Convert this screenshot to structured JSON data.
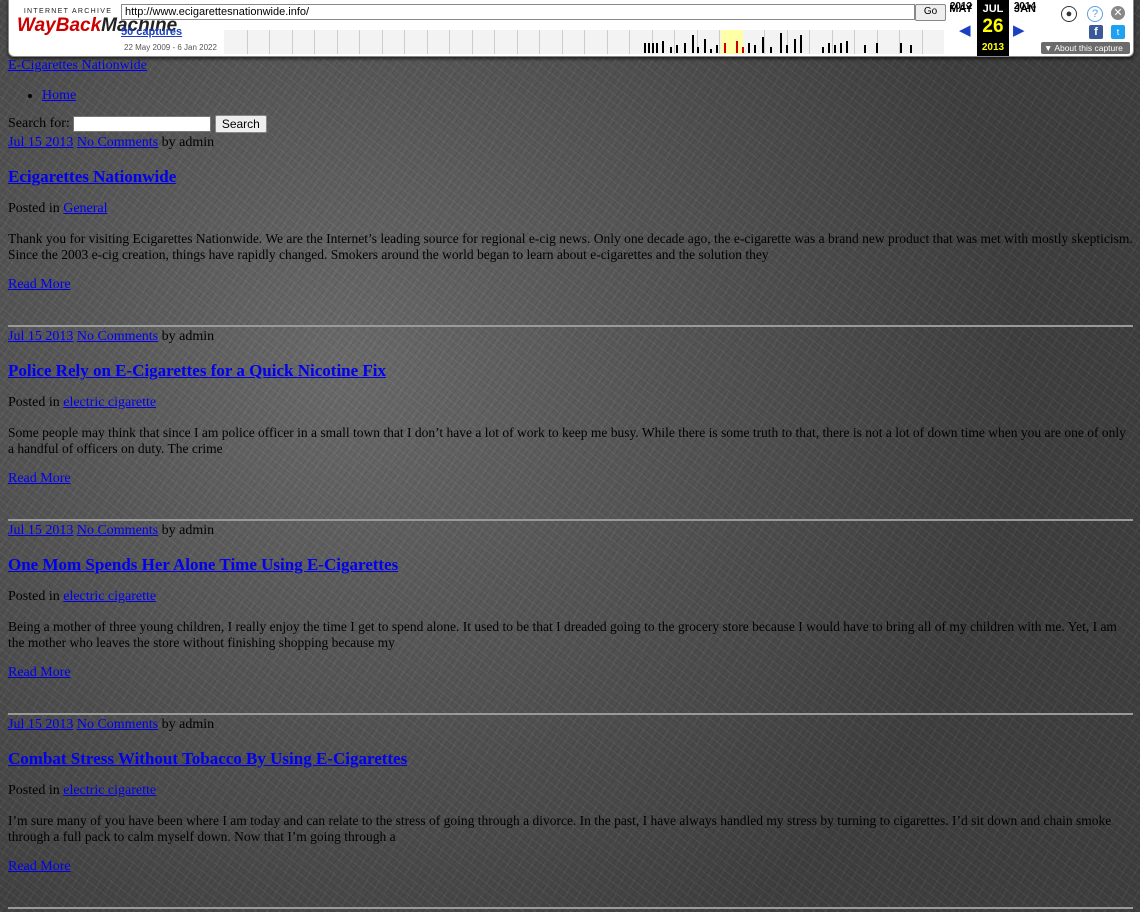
{
  "wayback": {
    "logo_top": "INTERNET ARCHIVE",
    "logo_word1": "WayBack",
    "logo_word2": "Machine",
    "url": "http://www.ecigarettesnationwide.info/",
    "go_label": "Go",
    "captures": "50 captures",
    "range": "22 May 2009 - 6 Jan 2022",
    "prev_month": "MAY",
    "prev_year": "2012",
    "cur_month": "JUL",
    "cur_day": "26",
    "cur_year": "2013",
    "next_month": "JAN",
    "next_year": "2014",
    "about": "About this capture"
  },
  "site": {
    "title": "E-Cigarettes Nationwide",
    "nav": [
      "Home"
    ],
    "search_label": "Search for:",
    "search_button": "Search"
  },
  "posts": [
    {
      "date": "Jul 15 2013",
      "comments": "No Comments",
      "by": "by admin",
      "title": "Ecigarettes Nationwide",
      "posted_in": "Posted in",
      "category": "General",
      "excerpt": "Thank you for visiting Ecigarettes Nationwide. We are the Internet’s leading source for regional e-cig news. Only one decade ago, the e-cigarette was a brand new product that was met with mostly skepticism. Since the 2003 e-cig creation, things have rapidly changed. Smokers around the world began to learn about e-cigarettes and the solution they",
      "more": "Read More"
    },
    {
      "date": "Jul 15 2013",
      "comments": "No Comments",
      "by": "by admin",
      "title": "Police Rely on E-Cigarettes for a Quick Nicotine Fix",
      "posted_in": "Posted in",
      "category": "electric cigarette",
      "excerpt": "Some people may think that since I am police officer in a small town that I don’t have a lot of work to keep me busy. While there is some truth to that, there is not a lot of down time when you are one of only a handful of officers on duty. The crime",
      "more": "Read More"
    },
    {
      "date": "Jul 15 2013",
      "comments": "No Comments",
      "by": "by admin",
      "title": "One Mom Spends Her Alone Time Using E-Cigarettes",
      "posted_in": "Posted in",
      "category": "electric cigarette",
      "excerpt": "Being a mother of three young children, I really enjoy the time I get to spend alone. It used to be that I dreaded going to the grocery store because I would have to bring all of my children with me. Yet, I am the mother who leaves the store without finishing shopping because my",
      "more": "Read More"
    },
    {
      "date": "Jul 15 2013",
      "comments": "No Comments",
      "by": "by admin",
      "title": "Combat Stress Without Tobacco By Using E-Cigarettes",
      "posted_in": "Posted in",
      "category": "electric cigarette",
      "excerpt": "I’m sure many of you have been where I am today and can relate to the stress of going through a divorce. In the past, I have always handled my stress by turning to cigarettes. I’d sit down and chain smoke through a full pack to calm myself down. Now that I’m going through a",
      "more": "Read More"
    }
  ]
}
